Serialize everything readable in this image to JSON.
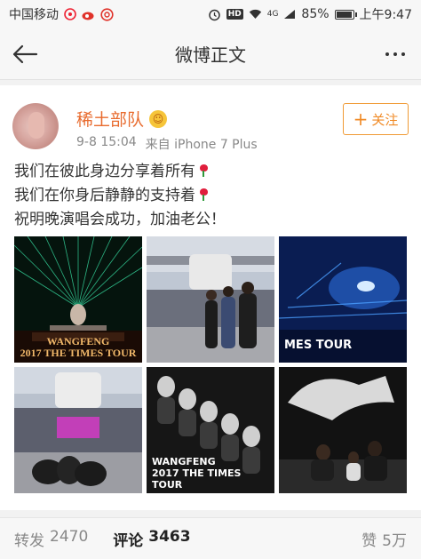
{
  "status_bar": {
    "carrier": "中国移动",
    "network": "4G",
    "battery": "85%",
    "battery_level": 0.85,
    "time": "上午9:47"
  },
  "header": {
    "title": "微博正文"
  },
  "post": {
    "author": "稀土部队",
    "time": "9-8 15:04",
    "source": "来自 iPhone 7 Plus",
    "follow_label": "关注",
    "text_lines": [
      "我们在彼此身边分享着所有",
      "我们在你身后静静的支持着",
      "祝明晚演唱会成功，加油老公！"
    ],
    "images": [
      {
        "caption_line1": "WANGFENG",
        "caption_line2": "2017 THE TIMES TOUR"
      },
      {
        "caption": ""
      },
      {
        "caption": "MES TOUR"
      },
      {
        "caption": ""
      },
      {
        "caption_line1": "WANGFENG",
        "caption_line2": "2017 THE TIMES TOUR"
      },
      {
        "caption": ""
      }
    ]
  },
  "actions": {
    "repost_label": "转发",
    "repost_count": "2470",
    "comment_label": "评论",
    "comment_count": "3463",
    "like_label": "赞",
    "like_count": "5万"
  },
  "colors": {
    "accent": "#e86b2e",
    "follow": "#f08a25"
  }
}
